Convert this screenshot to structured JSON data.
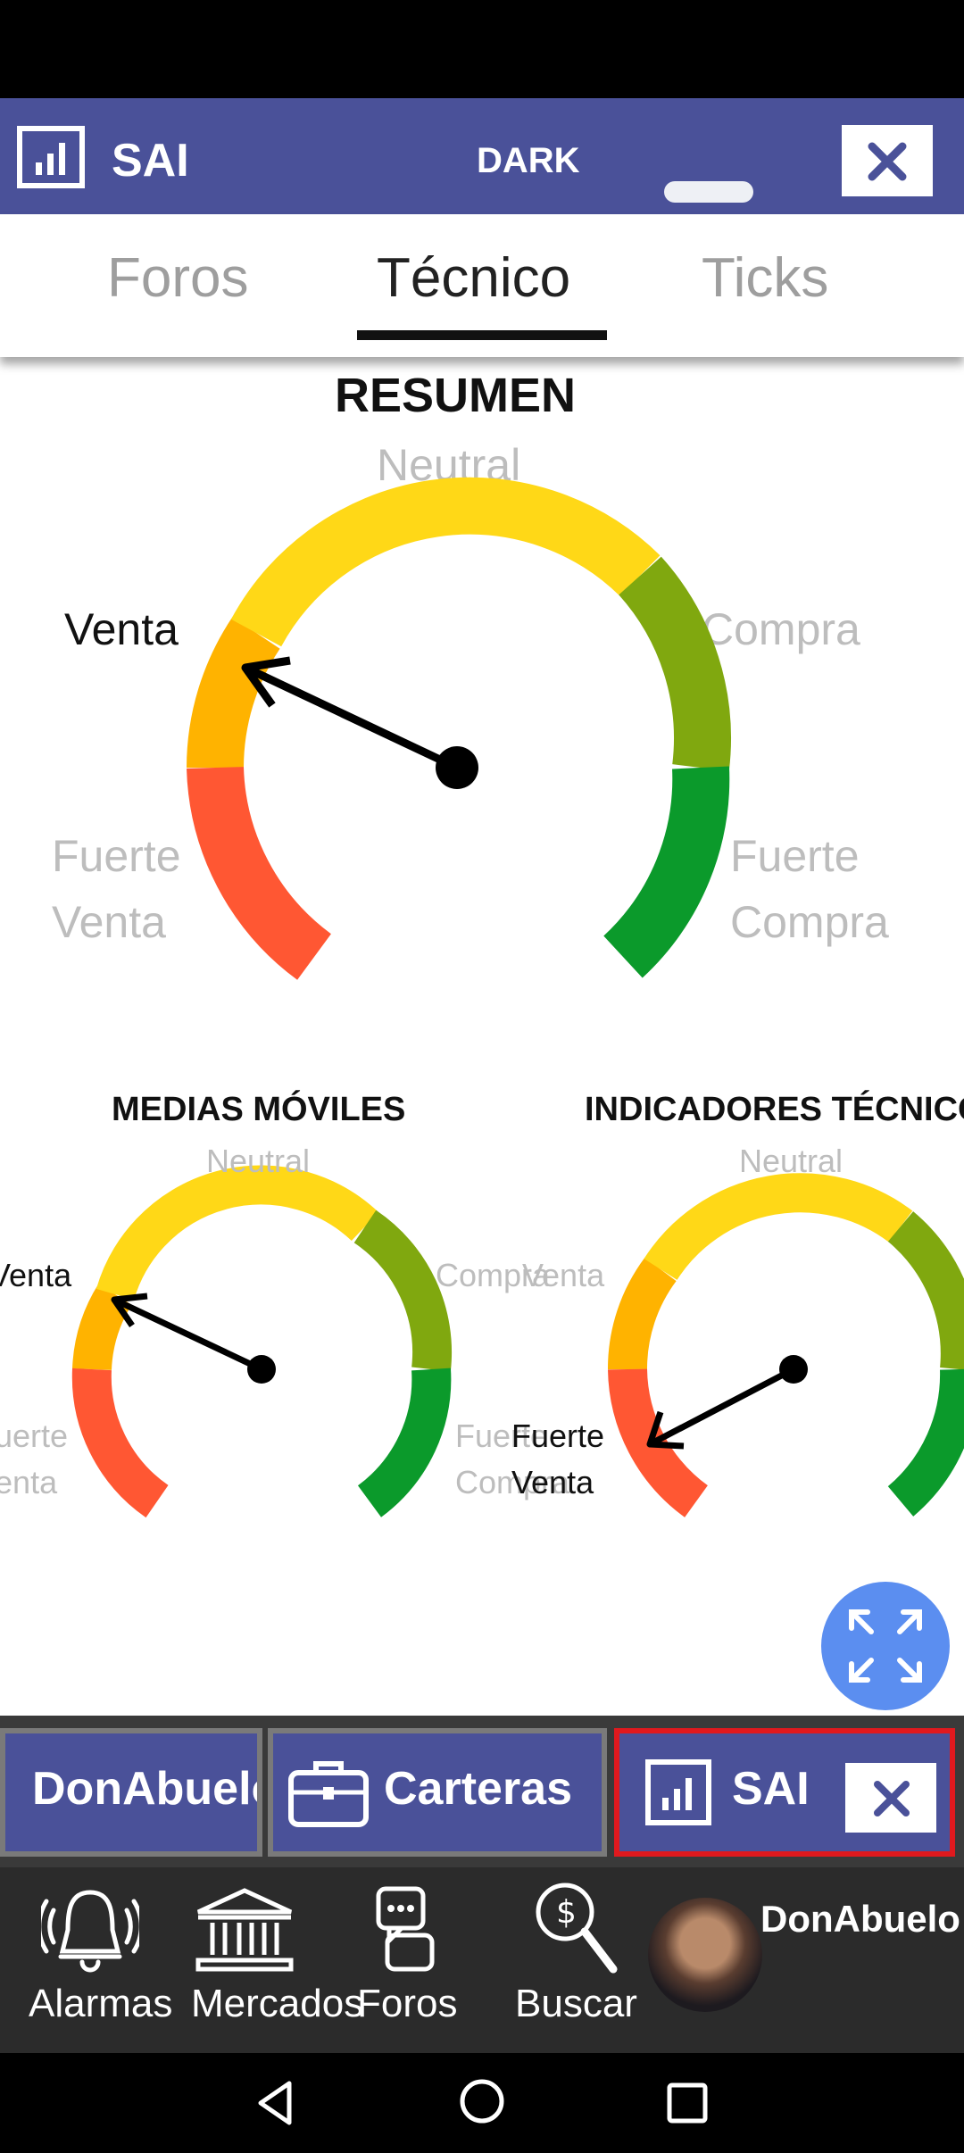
{
  "header": {
    "title": "SAI",
    "theme_label": "DARK"
  },
  "tabs": [
    {
      "label": "Foros",
      "active": false
    },
    {
      "label": "Técnico",
      "active": true
    },
    {
      "label": "Ticks",
      "active": false
    }
  ],
  "gauges": {
    "summary": {
      "title": "RESUMEN",
      "neutral": "Neutral",
      "venta": "Venta",
      "compra": "Compra",
      "fuerte_venta_1": "Fuerte",
      "fuerte_venta_2": "Venta",
      "fuerte_compra_1": "Fuerte",
      "fuerte_compra_2": "Compra",
      "selected": "Venta"
    },
    "moving_averages": {
      "title": "MEDIAS MÓVILES",
      "neutral": "Neutral",
      "venta": "Venta",
      "compra": "Compra",
      "fuerte_venta_1": "Fuerte",
      "fuerte_venta_2": "Venta",
      "fuerte_compra_1": "Fuerte",
      "fuerte_compra_2": "Compra",
      "selected": "Venta"
    },
    "technical_indicators": {
      "title": "INDICADORES TÉCNICOS",
      "neutral": "Neutral",
      "venta": "Venta",
      "fuerte_venta_1": "Fuerte",
      "fuerte_venta_2": "Venta",
      "selected": "Fuerte Venta"
    }
  },
  "taskbar": [
    {
      "label": "DonAbuelo",
      "icon": "none"
    },
    {
      "label": "Carteras",
      "icon": "briefcase-icon"
    },
    {
      "label": "SAI",
      "icon": "chart-icon",
      "active": true
    }
  ],
  "nav": [
    {
      "label": "Alarmas",
      "icon": "bell-icon"
    },
    {
      "label": "Mercados",
      "icon": "bank-icon"
    },
    {
      "label": "Foros",
      "icon": "chat-icon"
    },
    {
      "label": "Buscar",
      "icon": "search-money-icon"
    },
    {
      "label": "DonAbuelo",
      "icon": "avatar"
    }
  ],
  "colors": {
    "primary": "#4a5199",
    "strong_sell": "#ff5733",
    "sell": "#ffb300",
    "neutral": "#ffd817",
    "buy": "#80a80f",
    "strong_buy": "#0b9a2b",
    "highlight": "#e0191e"
  }
}
